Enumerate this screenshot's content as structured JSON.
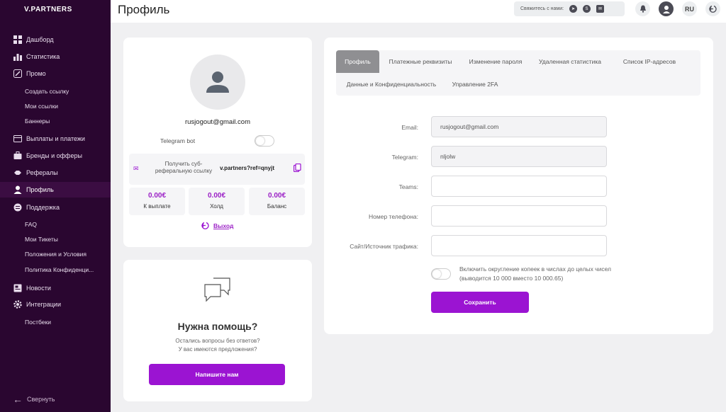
{
  "brand": {
    "logo": "V.PARTNERS"
  },
  "sidebar": {
    "items": [
      {
        "label": "Дашборд"
      },
      {
        "label": "Статистика"
      },
      {
        "label": "Промо"
      },
      {
        "label": "Создать ссылку"
      },
      {
        "label": "Мои ссылки"
      },
      {
        "label": "Баннеры"
      },
      {
        "label": "Выплаты и платежи"
      },
      {
        "label": "Бренды и офферы"
      },
      {
        "label": "Рефералы"
      },
      {
        "label": "Профиль"
      },
      {
        "label": "Поддержка"
      },
      {
        "label": "FAQ"
      },
      {
        "label": "Мои Тикеты"
      },
      {
        "label": "Положения и Условия"
      },
      {
        "label": "Политика Конфиденци..."
      },
      {
        "label": "Новости"
      },
      {
        "label": "Интеграции"
      },
      {
        "label": "Постбеки"
      }
    ],
    "collapse_label": "Свернуть"
  },
  "header": {
    "title": "Профиль",
    "contact_label": "Свяжитесь с нами:",
    "language": "RU"
  },
  "profile": {
    "email": "rusjogout@gmail.com",
    "telegram_bot_label": "Telegram bot",
    "referral_text": "Получить суб-реферальную ссылку",
    "referral_link": "v.partners?ref=qnyjt",
    "stats": [
      {
        "value": "0.00€",
        "label": "К выплате"
      },
      {
        "value": "0.00€",
        "label": "Холд"
      },
      {
        "value": "0.00€",
        "label": "Баланс"
      }
    ],
    "logout_label": "Выход"
  },
  "help": {
    "title": "Нужна помощь?",
    "line1": "Остались вопросы без ответов?",
    "line2": "У вас имеются предложения?",
    "button": "Напишите нам"
  },
  "tabs": [
    {
      "label": "Профиль"
    },
    {
      "label": "Платежные реквизиты"
    },
    {
      "label": "Изменение пароля"
    },
    {
      "label": "Удаленная статистика"
    },
    {
      "label": "Список IP-адресов"
    },
    {
      "label": "Данные и Конфиденциальность"
    },
    {
      "label": "Управление 2FA"
    }
  ],
  "form": {
    "email_label": "Email:",
    "email_value": "rusjogout@gmail.com",
    "telegram_label": "Telegram:",
    "telegram_value": "nljolw",
    "teams_label": "Teams:",
    "phone_label": "Номер телефона:",
    "site_label": "Сайт/Источник трафика:",
    "rounding_text": "Включить округление копеек в числах до целых чисел (выводится 10 000 вместо 10 000.65)",
    "save_button": "Сохранить"
  },
  "colors": {
    "accent": "#9b14d2",
    "sidebar_bg": "#2a0630"
  }
}
